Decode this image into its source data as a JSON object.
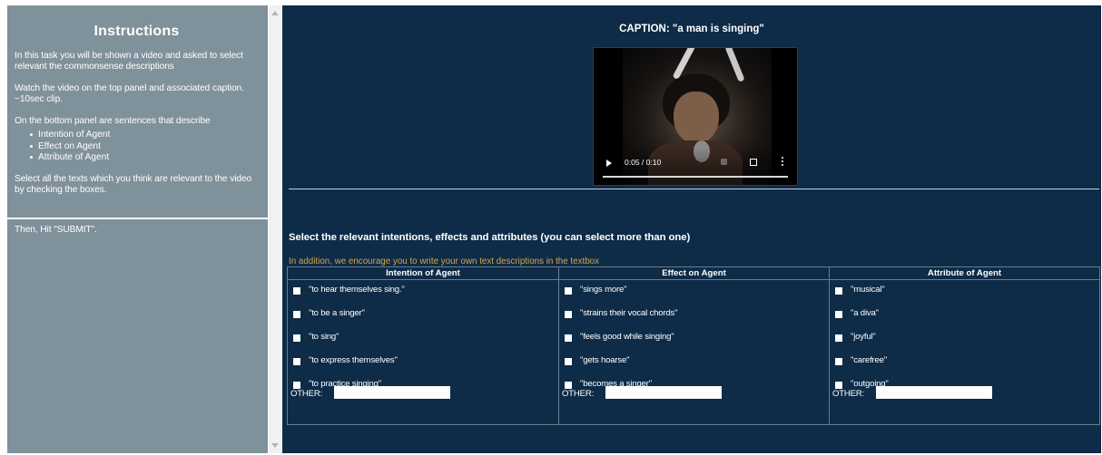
{
  "sidebar": {
    "title": "Instructions",
    "paragraphs": [
      "In this task you will be shown a video and asked to select relevant the commonsense descriptions",
      "Watch the video on the top panel and associated caption. ~10sec clip.",
      "On the bottom panel are sentences that describe"
    ],
    "bullets": [
      "Intention of Agent",
      "Effect on Agent",
      "Attribute of Agent"
    ],
    "after_list": "Select all the texts which you think are relevant to the video by checking the boxes.",
    "final": "Then, Hit \"SUBMIT\"."
  },
  "caption": "CAPTION: \"a man is singing\"",
  "video": {
    "time": "0:05 / 0:10",
    "progress_fraction": 0.5
  },
  "select_heading": "Select the relevant intentions, effects and attributes (you can select more than one)",
  "encourage_text": "In addition, we encourage you to write your own text descriptions in the textbox",
  "columns": [
    {
      "header": "Intention of Agent",
      "options": [
        "\"to hear themselves sing.\"",
        "\"to be a singer\"",
        "\"to sing\"",
        "\"to express themselves\"",
        "\"to practice singing\""
      ],
      "other_label": "OTHER:"
    },
    {
      "header": "Effect on Agent",
      "options": [
        "\"sings more\"",
        "\"strains their vocal chords\"",
        "\"feels good while singing\"",
        "\"gets hoarse\"",
        "\"becomes a singer\""
      ],
      "other_label": "OTHER:"
    },
    {
      "header": "Attribute of Agent",
      "options": [
        "\"musical\"",
        "\"a diva\"",
        "\"joyful\"",
        "\"carefree\"",
        "\"outgoing\""
      ],
      "other_label": "OTHER:"
    }
  ],
  "colors": {
    "sidebar_bg": "#7f919b",
    "main_bg": "#0e2b47",
    "encourage_text": "#d4a44c"
  }
}
